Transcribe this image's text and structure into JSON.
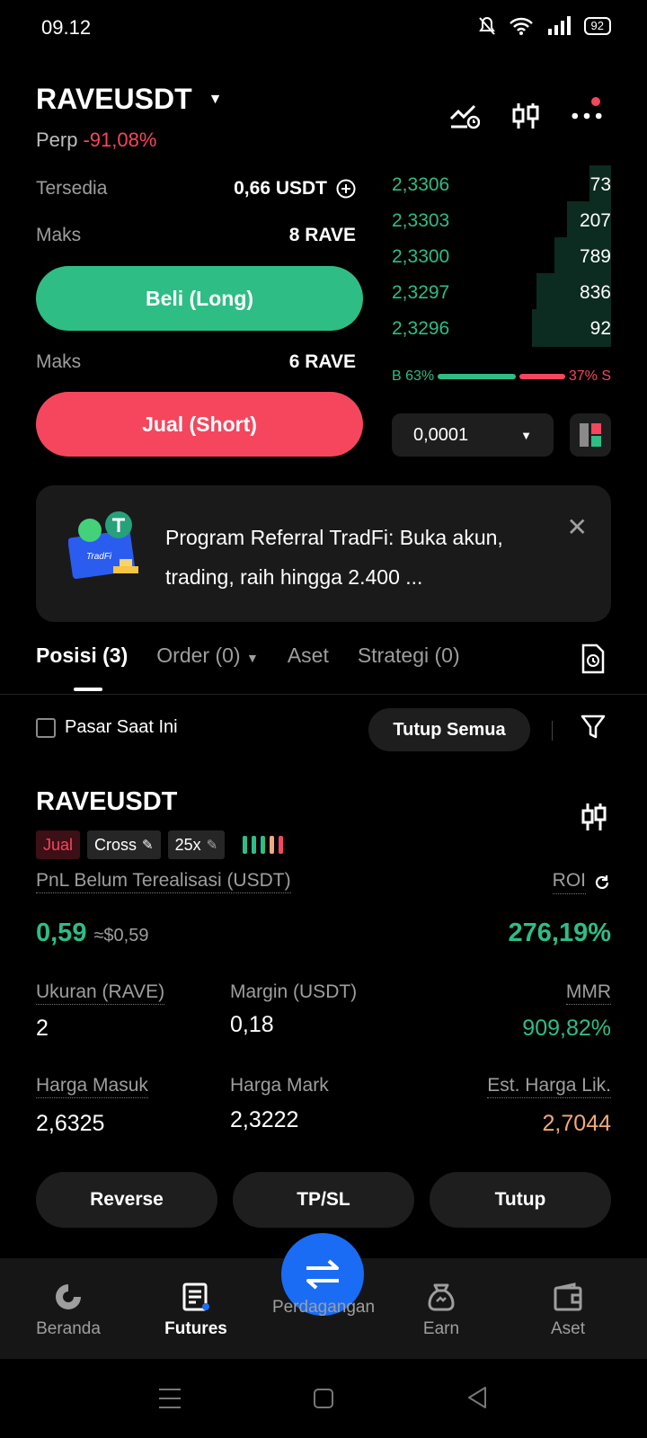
{
  "status_bar": {
    "time": "09.12",
    "battery": "92"
  },
  "header": {
    "pair": "RAVEUSDT",
    "market_type": "Perp",
    "change": "-91,08%"
  },
  "trade": {
    "available_label": "Tersedia",
    "available_value": "0,66 USDT",
    "max_label": "Maks",
    "max_long": "8 RAVE",
    "long_button": "Beli (Long)",
    "max_short": "6 RAVE",
    "short_button": "Jual (Short)"
  },
  "order_book": {
    "bids": [
      {
        "price": "2,3306",
        "qty": "73",
        "depth": 0.1
      },
      {
        "price": "2,3303",
        "qty": "207",
        "depth": 0.2
      },
      {
        "price": "2,3300",
        "qty": "789",
        "depth": 0.26
      },
      {
        "price": "2,3297",
        "qty": "836",
        "depth": 0.34
      },
      {
        "price": "2,3296",
        "qty": "92",
        "depth": 0.36
      }
    ],
    "buy_ratio": "B 63%",
    "sell_ratio": "37% S",
    "tick_size": "0,0001"
  },
  "banner": {
    "text": "Program Referral TradFi: Buka akun, trading, raih hingga 2.400 ...",
    "badge": "TradFi"
  },
  "tabs": [
    {
      "label": "Posisi (3)"
    },
    {
      "label": "Order (0)"
    },
    {
      "label": "Aset"
    },
    {
      "label": "Strategi (0)"
    }
  ],
  "filters": {
    "current_market_label": "Pasar Saat Ini",
    "close_all": "Tutup Semua"
  },
  "position": {
    "symbol": "RAVEUSDT",
    "side": "Jual",
    "margin_mode": "Cross",
    "leverage": "25x",
    "pnl_label": "PnL Belum Terealisasi (USDT)",
    "pnl_value": "0,59",
    "pnl_usd": "≈$0,59",
    "roi_label": "ROI",
    "roi_value": "276,19%",
    "size_label": "Ukuran (RAVE)",
    "size_value": "2",
    "margin_label": "Margin (USDT)",
    "margin_value": "0,18",
    "mmr_label": "MMR",
    "mmr_value": "909,82%",
    "entry_label": "Harga Masuk",
    "entry_value": "2,6325",
    "mark_label": "Harga Mark",
    "mark_value": "2,3222",
    "liq_label": "Est. Harga Lik.",
    "liq_value": "2,7044",
    "actions": [
      "Reverse",
      "TP/SL",
      "Tutup"
    ]
  },
  "bottom_nav": [
    {
      "label": "Beranda"
    },
    {
      "label": "Futures"
    },
    {
      "label": "Perdagangan"
    },
    {
      "label": "Earn"
    },
    {
      "label": "Aset"
    }
  ],
  "colors": {
    "green": "#2ebd85",
    "red": "#f6465d",
    "blue": "#1a6cf5",
    "orange": "#f0a97a"
  }
}
